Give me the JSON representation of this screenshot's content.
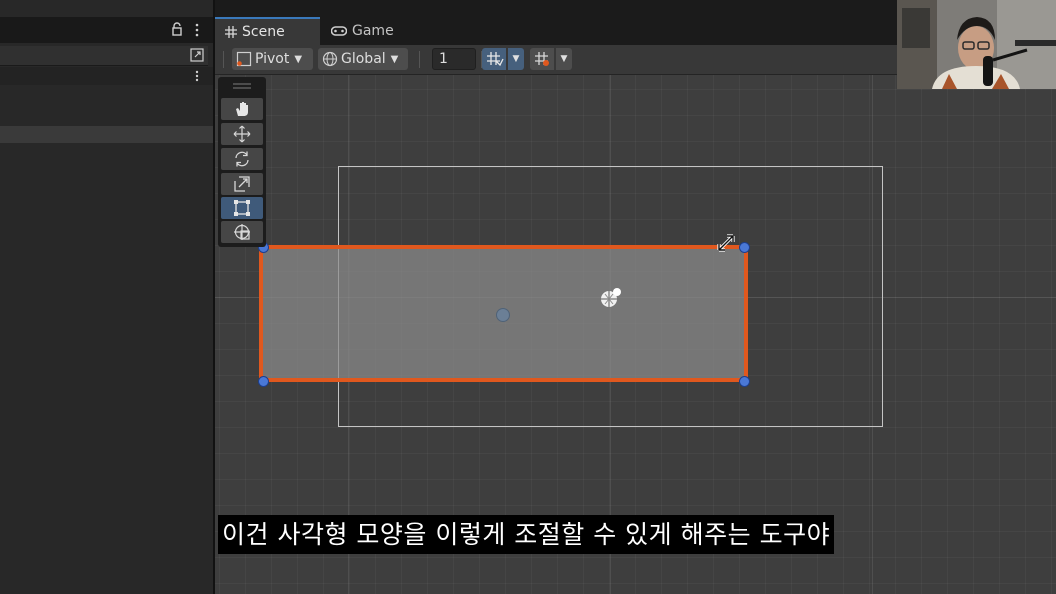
{
  "tabs": {
    "scene_label": "Scene",
    "game_label": "Game",
    "scene_icon": "grid-hash-icon",
    "game_icon": "gamepad-icon"
  },
  "toolbar": {
    "pivot_label": "Pivot",
    "global_label": "Global",
    "grid_size_value": "1",
    "accent_color": "#46607d"
  },
  "tools": [
    {
      "name": "hand-tool",
      "icon": "hand-icon",
      "active": false
    },
    {
      "name": "move-tool",
      "icon": "move-arrows-icon",
      "active": false
    },
    {
      "name": "rotate-tool",
      "icon": "rotate-icon",
      "active": false
    },
    {
      "name": "scale-tool",
      "icon": "scale-icon",
      "active": false
    },
    {
      "name": "rect-tool",
      "icon": "rect-transform-icon",
      "active": true
    },
    {
      "name": "transform-tool",
      "icon": "transform-icon",
      "active": false
    }
  ],
  "scene": {
    "selection_color": "#e0581e",
    "handle_color": "#4a78d6"
  },
  "subtitle": {
    "text": "이건 사각형 모양을 이렇게 조절할 수 있게 해주는 도구야"
  }
}
